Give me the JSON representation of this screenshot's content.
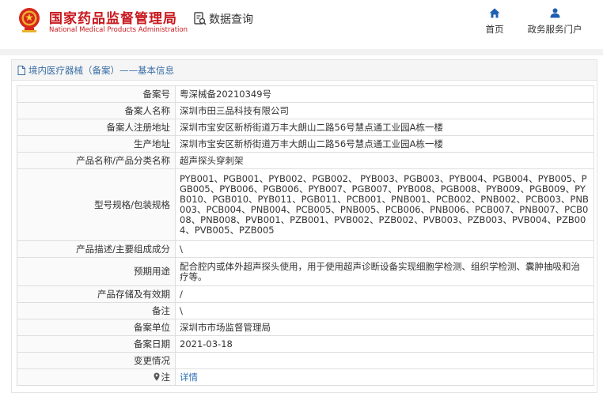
{
  "header": {
    "title_cn": "国家药品监督管理局",
    "title_en": "National Medical Products Administration",
    "query_label": "数据查询",
    "nav": [
      {
        "label": "首页",
        "icon": "home-icon"
      },
      {
        "label": "政务服务门户",
        "icon": "user-icon"
      }
    ]
  },
  "panel": {
    "heading": "境内医疗器械（备案）——基本信息"
  },
  "rows": [
    {
      "label": "备案号",
      "value": "粤深械备20210349号"
    },
    {
      "label": "备案人名称",
      "value": "深圳市田三品科技有限公司"
    },
    {
      "label": "备案人注册地址",
      "value": "深圳市宝安区新桥街道万丰大朗山二路56号慧点通工业园A栋一楼"
    },
    {
      "label": "生产地址",
      "value": "深圳市宝安区新桥街道万丰大朗山二路56号慧点通工业园A栋一楼"
    },
    {
      "label": "产品名称/产品分类名称",
      "value": "超声探头穿刺架"
    },
    {
      "label": "型号规格/包装规格",
      "value": "PYB001、PGB001、PYB002、PGB002、 PYB003、PGB003、PYB004、PGB004、PYB005、PGB005、PYB006、PGB006、PYB007、PGB007、PYB008、PGB008、PYB009、PGB009、PYB010、PGB010、PYB011、PGB011、PCB001、PNB001、PCB002、PNB002、PCB003、PNB003、PCB004、PNB004、PCB005、PNB005、PCB006、PNB006、PCB007、PNB007、PCB008、PNB008、PVB001、PZB001、PVB002、PZB002、PVB003、PZB003、PVB004、PZB004、PVB005、PZB005"
    },
    {
      "label": "产品描述/主要组成成分",
      "value": "\\"
    },
    {
      "label": "预期用途",
      "value": "配合腔内或体外超声探头使用，用于使用超声诊断设备实现细胞学检测、组织学检测、囊肿抽吸和治疗等。"
    },
    {
      "label": "产品存储及有效期",
      "value": "/"
    },
    {
      "label": "备注",
      "value": "\\"
    },
    {
      "label": "备案单位",
      "value": "深圳市市场监督管理局"
    },
    {
      "label": "备案日期",
      "value": "2021-03-18"
    },
    {
      "label": "变更情况",
      "value": ""
    },
    {
      "label": "注",
      "value": "详情",
      "icon": "location-pin-icon",
      "link": true
    }
  ],
  "colors": {
    "brand_red": "#c8171d",
    "heading_blue": "#3a6ea5",
    "link_blue": "#2d6fb6",
    "nav_icon_blue": "#1f5fb0"
  }
}
